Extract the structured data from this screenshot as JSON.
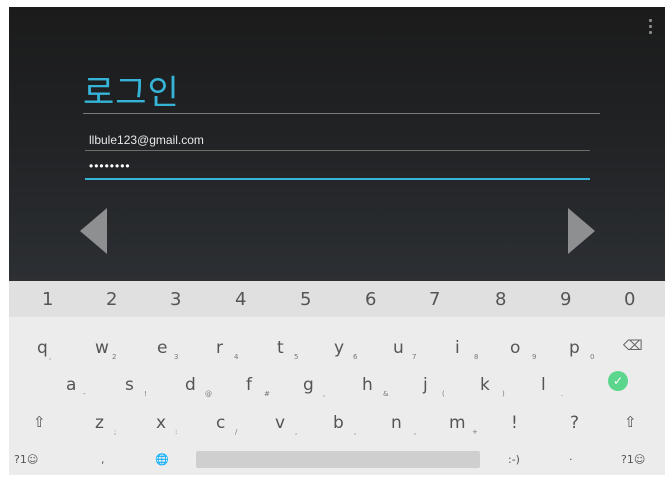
{
  "login": {
    "title": "로그인",
    "email_value": "llbule123@gmail.com",
    "password_mask": "••••••••"
  },
  "keyboard": {
    "numbers": [
      "1",
      "2",
      "3",
      "4",
      "5",
      "6",
      "7",
      "8",
      "9",
      "0"
    ],
    "row1": [
      {
        "key": "q",
        "hint": ","
      },
      {
        "key": "w",
        "hint": "2"
      },
      {
        "key": "e",
        "hint": "3"
      },
      {
        "key": "r",
        "hint": "4"
      },
      {
        "key": "t",
        "hint": "5"
      },
      {
        "key": "y",
        "hint": "6"
      },
      {
        "key": "u",
        "hint": "7"
      },
      {
        "key": "i",
        "hint": "8"
      },
      {
        "key": "o",
        "hint": "9"
      },
      {
        "key": "p",
        "hint": "0"
      }
    ],
    "row2": [
      {
        "key": "a",
        "hint": "-"
      },
      {
        "key": "s",
        "hint": "!"
      },
      {
        "key": "d",
        "hint": "@"
      },
      {
        "key": "f",
        "hint": "#"
      },
      {
        "key": "g",
        "hint": ","
      },
      {
        "key": "h",
        "hint": "&"
      },
      {
        "key": "j",
        "hint": "("
      },
      {
        "key": "k",
        "hint": ")"
      },
      {
        "key": "l",
        "hint": "."
      }
    ],
    "row3": [
      {
        "key": "z",
        "hint": ";"
      },
      {
        "key": "x",
        "hint": ":"
      },
      {
        "key": "c",
        "hint": "/"
      },
      {
        "key": "v",
        "hint": ","
      },
      {
        "key": "b",
        "hint": ","
      },
      {
        "key": "n",
        "hint": ","
      },
      {
        "key": "m",
        "hint": "+"
      },
      {
        "key": "!",
        "hint": ""
      },
      {
        "key": "?",
        "hint": ""
      }
    ],
    "bottom": {
      "left_sym": "?1☺",
      "comma": ",",
      "smiley": ":-)",
      "dot": "·",
      "right_sym": "?1☺"
    },
    "colors": {
      "enter": "#5cd68d",
      "accent": "#35b4d8"
    }
  }
}
